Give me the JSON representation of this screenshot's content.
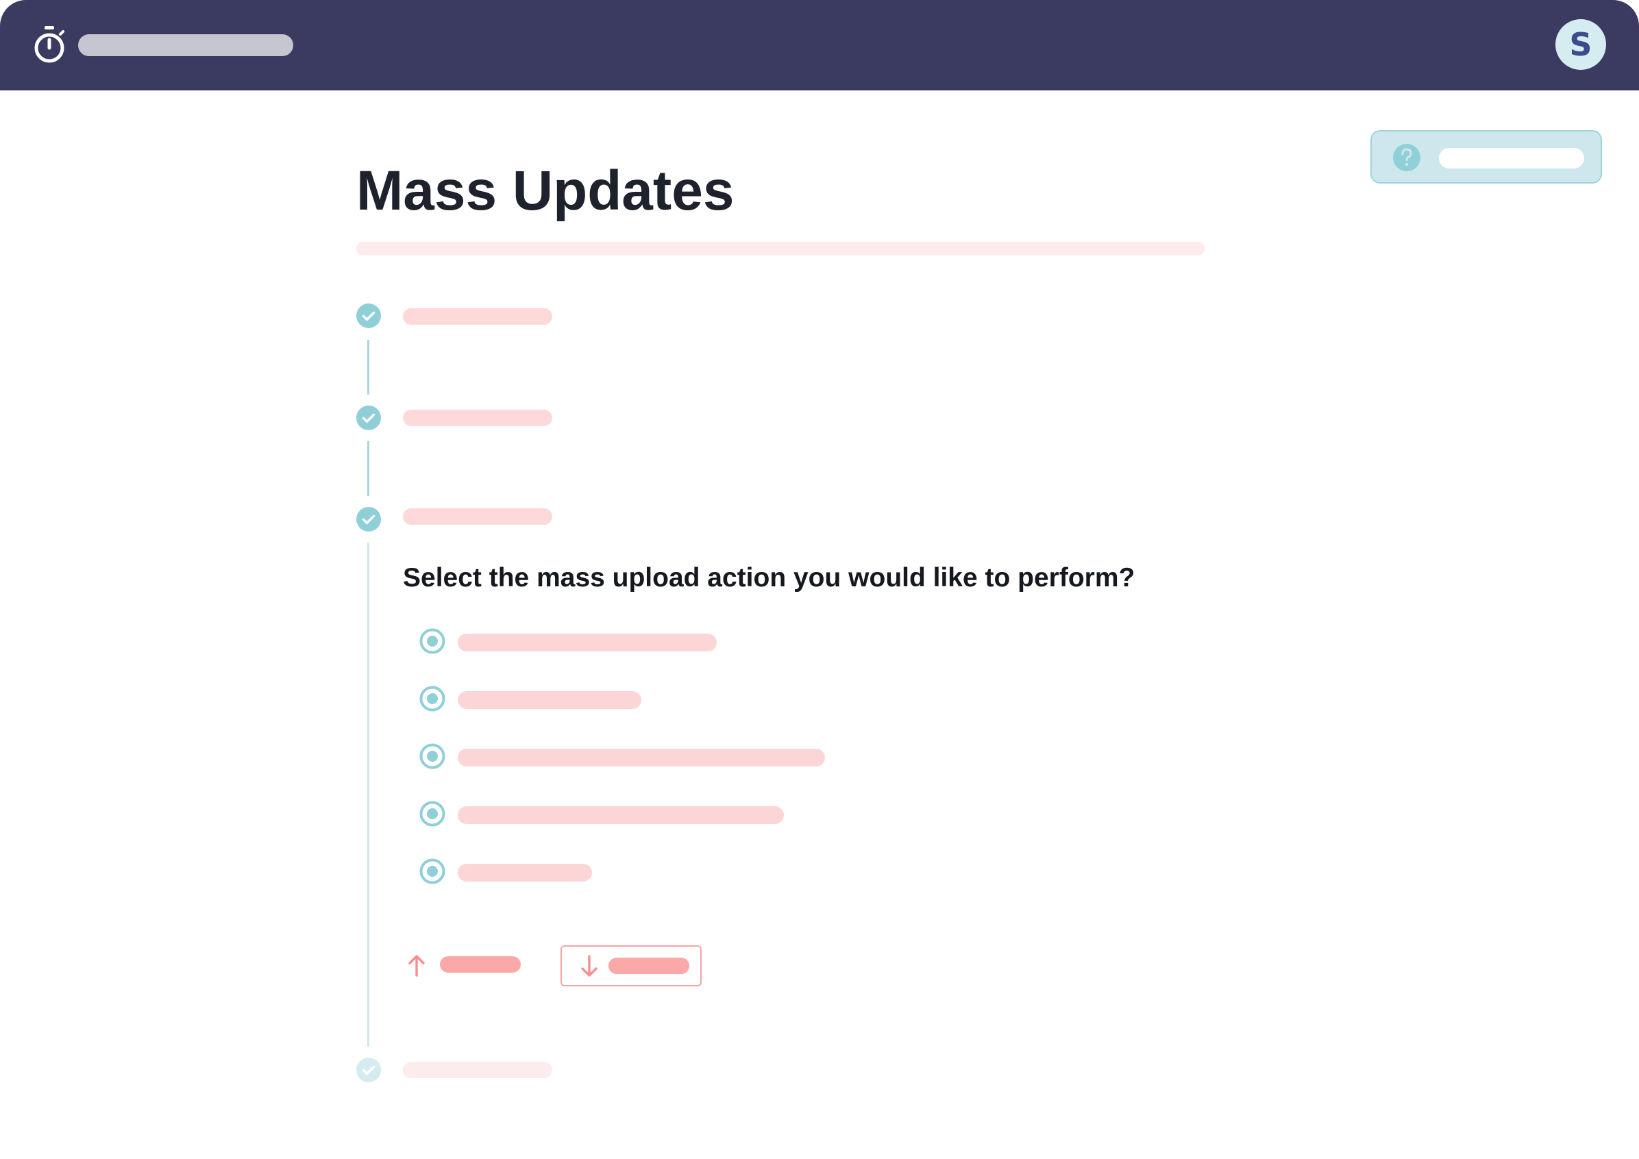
{
  "header": {
    "timer_icon": "stopwatch-icon",
    "avatar_initial": "S",
    "colors": {
      "bar": "#3b3b61",
      "avatar_bg": "#d5ecf0",
      "avatar_text": "#3d4a8f"
    }
  },
  "help": {
    "icon": "question-circle-icon",
    "colors": {
      "bg": "#cde7ec",
      "border": "#9fd3dc",
      "icon": "#8fcfd8"
    }
  },
  "page": {
    "title": "Mass Updates"
  },
  "steps": [
    {
      "state": "complete",
      "icon": "check-circle-icon"
    },
    {
      "state": "complete",
      "icon": "check-circle-icon"
    },
    {
      "state": "complete",
      "icon": "check-circle-icon"
    },
    {
      "state": "pending",
      "icon": "check-circle-icon"
    }
  ],
  "current_step": {
    "question": "Select the mass upload action you would like to perform?",
    "options_count": 5,
    "selected_style": "radio-icon"
  },
  "actions": {
    "upload_icon": "arrow-up-icon",
    "download_icon": "arrow-down-icon",
    "colors": {
      "accent": "#f38f93",
      "skeleton": "#fba8a8"
    }
  },
  "accent_colors": {
    "teal": "#8fcfd8",
    "pink_skeleton": "#fcd6d7"
  }
}
